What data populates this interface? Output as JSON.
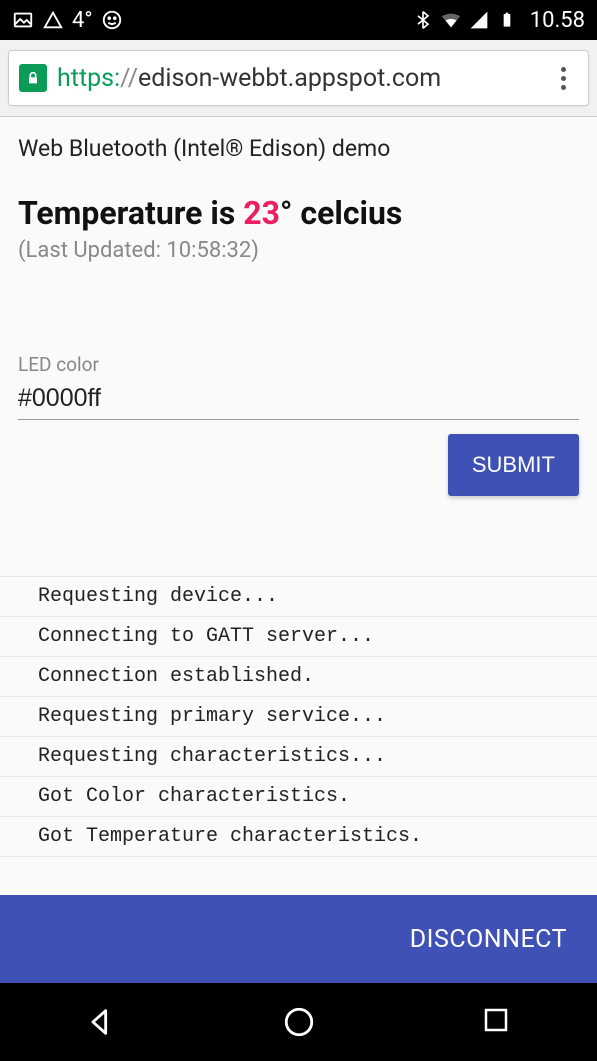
{
  "statusbar": {
    "temp": "4°",
    "time": "10.58"
  },
  "urlbar": {
    "scheme": "https:",
    "sep": "//",
    "host": "edison-webbt.appspot.com"
  },
  "page": {
    "demo_title": "Web Bluetooth (Intel® Edison) demo",
    "temp_prefix": "Temperature is ",
    "temp_value": "23",
    "temp_suffix": "° celcius",
    "last_updated": "(Last Updated: 10:58:32)",
    "input_label": "LED color",
    "input_value": "#0000ff",
    "submit_label": "SUBMIT",
    "log": [
      "Requesting device...",
      "Connecting to GATT server...",
      "Connection established.",
      "Requesting primary service...",
      "Requesting characteristics...",
      "Got Color characteristics.",
      "Got Temperature characteristics."
    ]
  },
  "bottombar": {
    "disconnect_label": "DISCONNECT"
  }
}
